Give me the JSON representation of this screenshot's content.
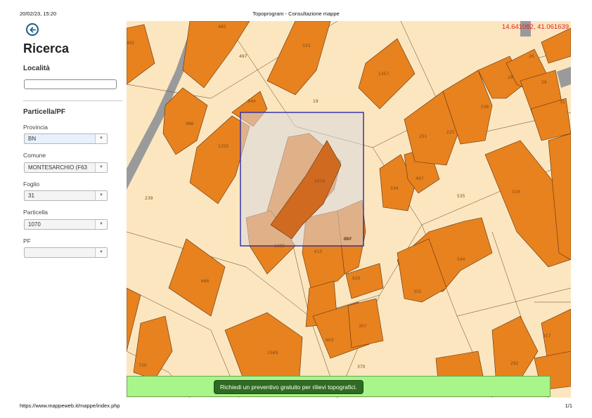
{
  "print_header": {
    "datetime": "20/02/23, 15:20",
    "title": "Topoprogram - Consultazione mappe"
  },
  "print_footer": {
    "url": "https://www.mappeweb.it/mappe/index.php",
    "page": "1/1"
  },
  "sidebar": {
    "back_icon": "arrow-left-circle-icon",
    "title": "Ricerca",
    "localita_label": "Località",
    "localita_value": "",
    "particella_section": "Particella/PF",
    "fields": [
      {
        "label": "Provincia",
        "value": "BN"
      },
      {
        "label": "Comune",
        "value": "MONTESARCHIO (F63"
      },
      {
        "label": "Foglio",
        "value": "31"
      },
      {
        "label": "Particella",
        "value": "1070"
      },
      {
        "label": "PF",
        "value": ""
      }
    ]
  },
  "map": {
    "coordinates": "14.641082, 41.061639",
    "parcel_labels": [
      "485",
      "492",
      "497",
      "333",
      "1357",
      "19",
      "344",
      "486",
      "1355",
      "1070",
      "239",
      "1385",
      "404",
      "387",
      "615",
      "620",
      "666",
      "1569",
      "603",
      "307",
      "730",
      "370",
      "251",
      "225",
      "536",
      "28",
      "29",
      "26",
      "31",
      "497",
      "334",
      "535",
      "319",
      "544",
      "355",
      "317",
      "292",
      "530"
    ],
    "colors": {
      "land": "#fce6bf",
      "building": "#e8821e",
      "road": "#9a9a9a",
      "selection": "#2a2aa8",
      "label": "#7a4a1a"
    }
  },
  "banner": {
    "text": "Richiedi un preventivo gratuito per rilievi topografici."
  }
}
